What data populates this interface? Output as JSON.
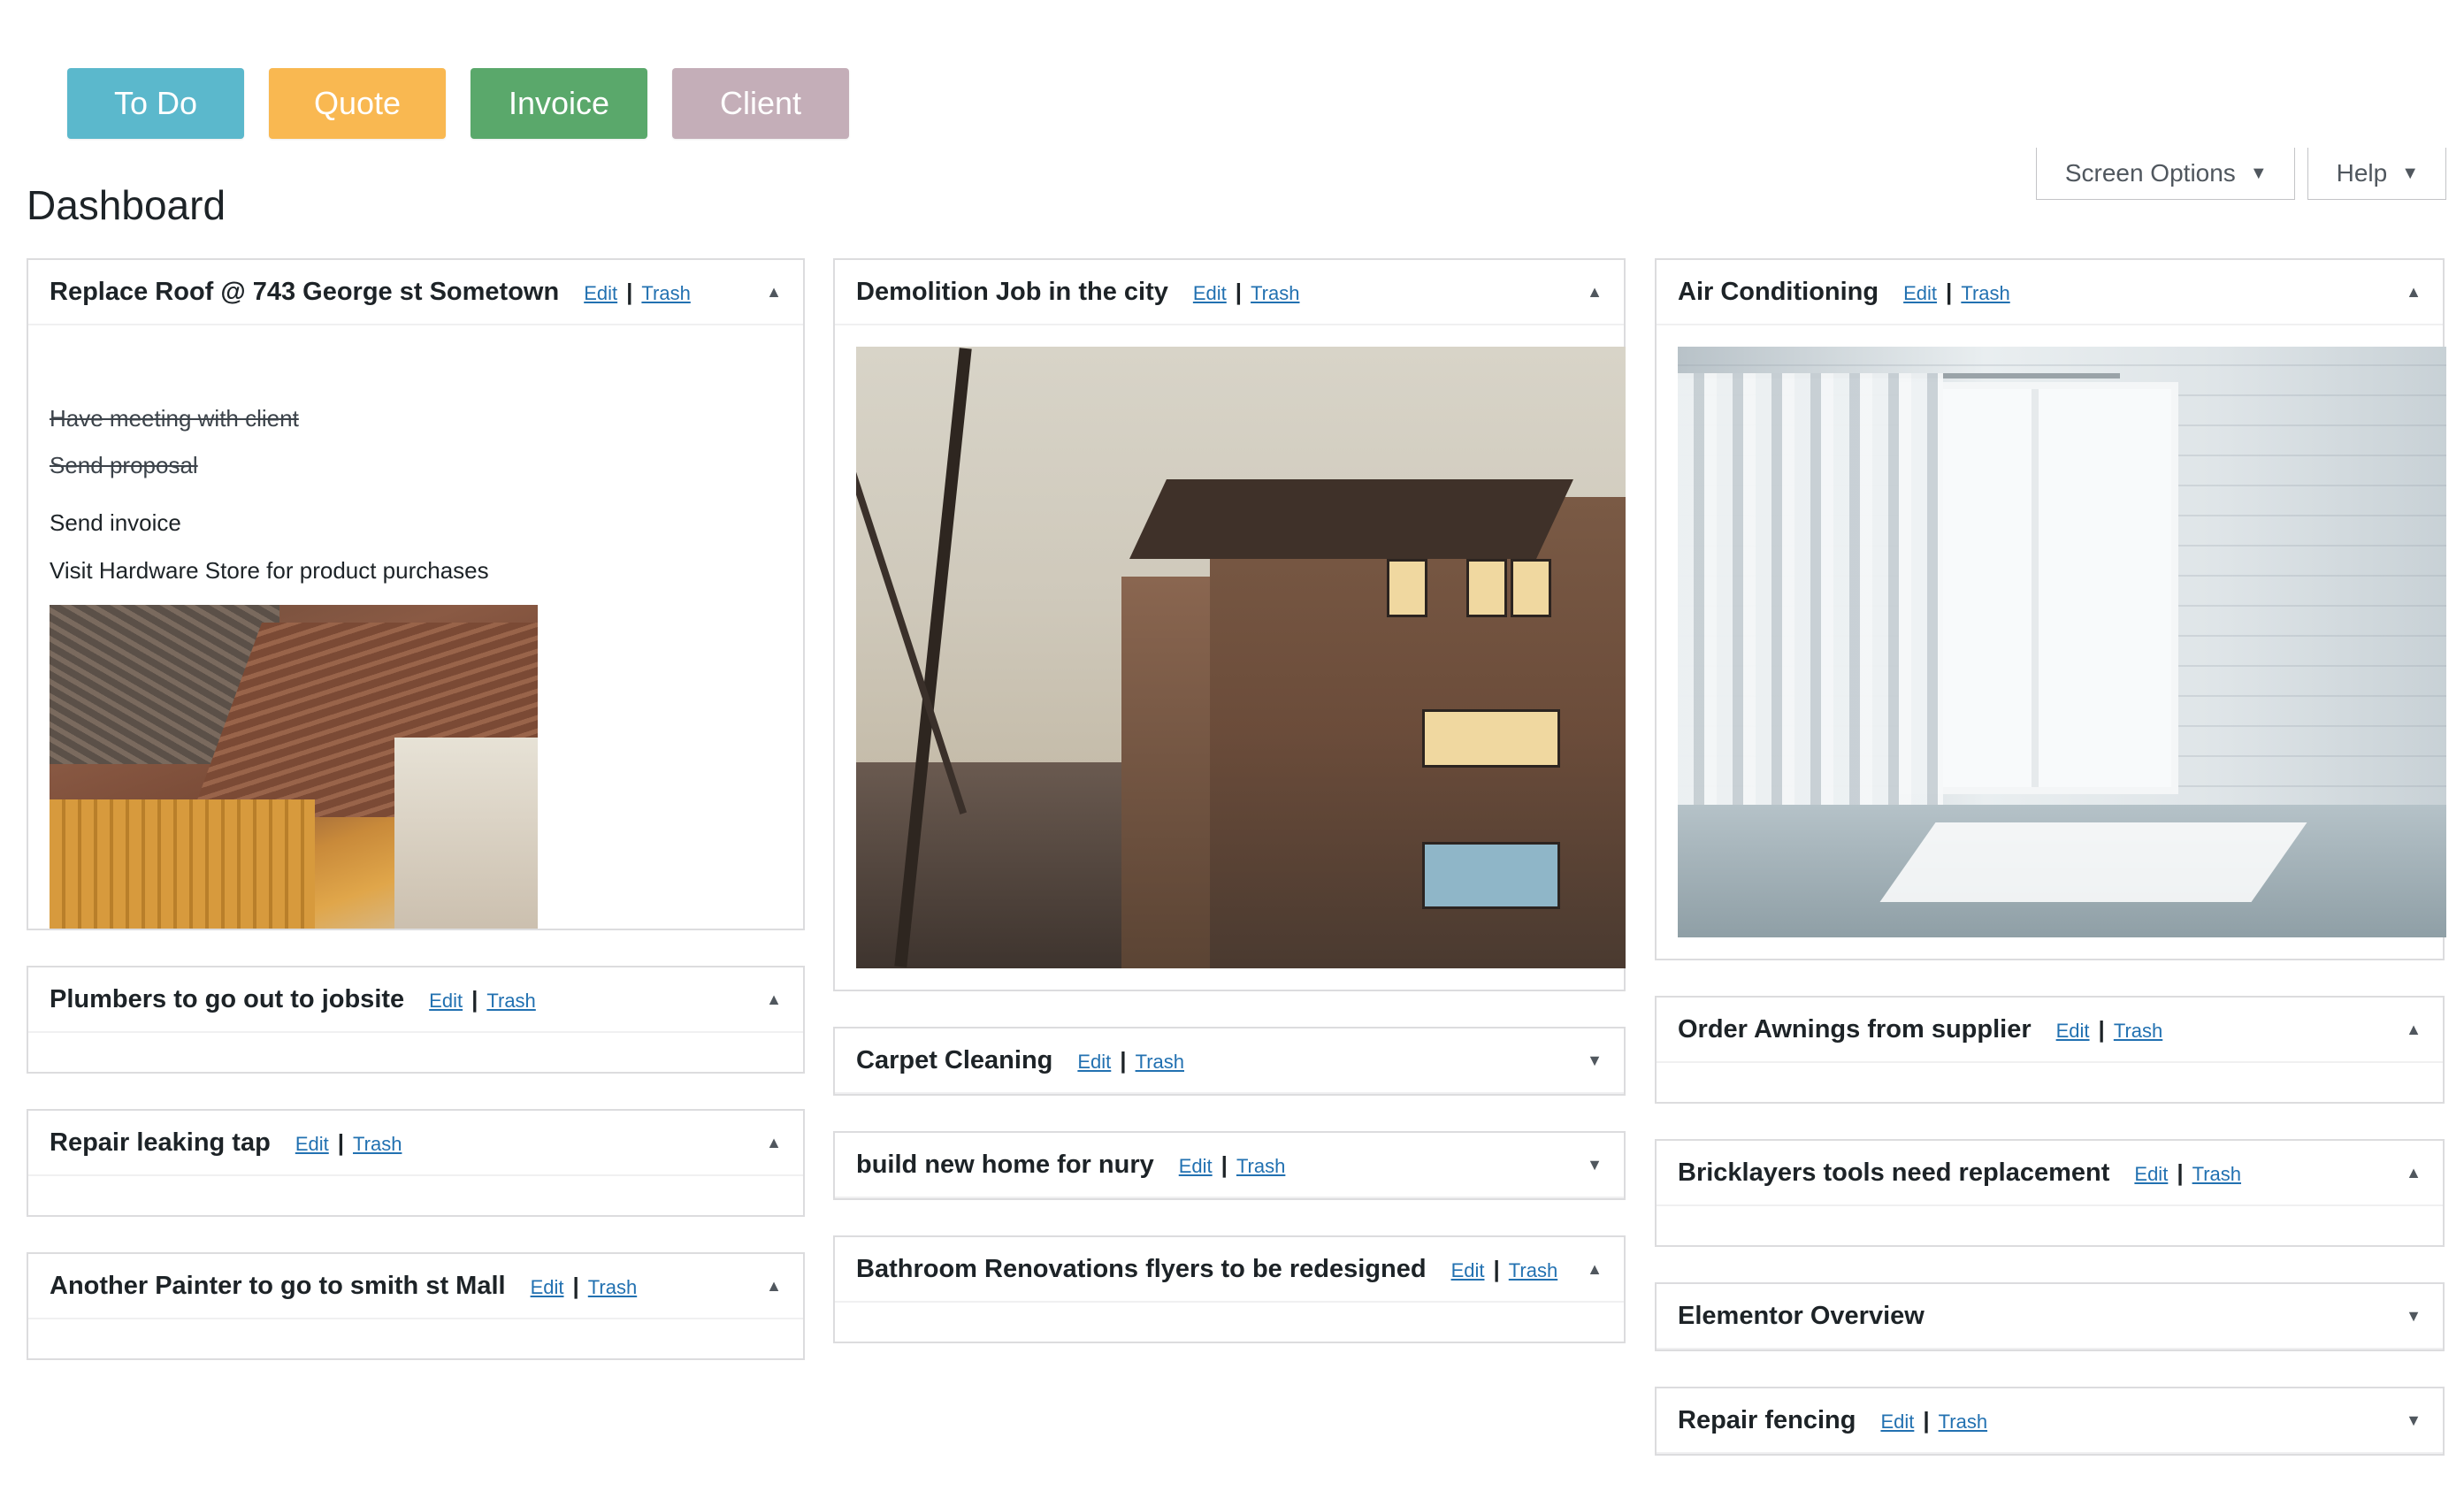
{
  "top_buttons": [
    {
      "label": "To Do",
      "color": "#5bb8cc"
    },
    {
      "label": "Quote",
      "color": "#f9b851"
    },
    {
      "label": "Invoice",
      "color": "#5aa86b"
    },
    {
      "label": "Client",
      "color": "#c4aeb8"
    }
  ],
  "screen_options": {
    "label": "Screen Options"
  },
  "help": {
    "label": "Help"
  },
  "page_title": "Dashboard",
  "links": {
    "edit": "Edit",
    "trash": "Trash",
    "sep": "|"
  },
  "icons": {
    "collapse": "▲",
    "expand": "▼"
  },
  "boxes": {
    "replace_roof": {
      "title": "Replace Roof @ 743 George st Sometown",
      "todos": [
        {
          "text": "Have meeting with client",
          "done": true
        },
        {
          "text": "Send proposal",
          "done": true
        },
        {
          "text": "Send invoice",
          "done": false
        },
        {
          "text": "Visit Hardware Store for product purchases",
          "done": false
        }
      ]
    },
    "plumbers": {
      "title": "Plumbers to go out to jobsite"
    },
    "repair_tap": {
      "title": "Repair leaking tap"
    },
    "painter": {
      "title": "Another Painter to go to smith st Mall"
    },
    "demolition": {
      "title": "Demolition Job in the city"
    },
    "carpet": {
      "title": "Carpet Cleaning"
    },
    "build_home": {
      "title": "build new home for nury"
    },
    "bathroom": {
      "title": "Bathroom Renovations flyers to be redesigned"
    },
    "air_con": {
      "title": "Air Conditioning"
    },
    "awnings": {
      "title": "Order Awnings from supplier"
    },
    "bricklayers": {
      "title": "Bricklayers tools need replacement"
    },
    "elementor": {
      "title": "Elementor Overview"
    },
    "fencing": {
      "title": "Repair fencing"
    }
  }
}
